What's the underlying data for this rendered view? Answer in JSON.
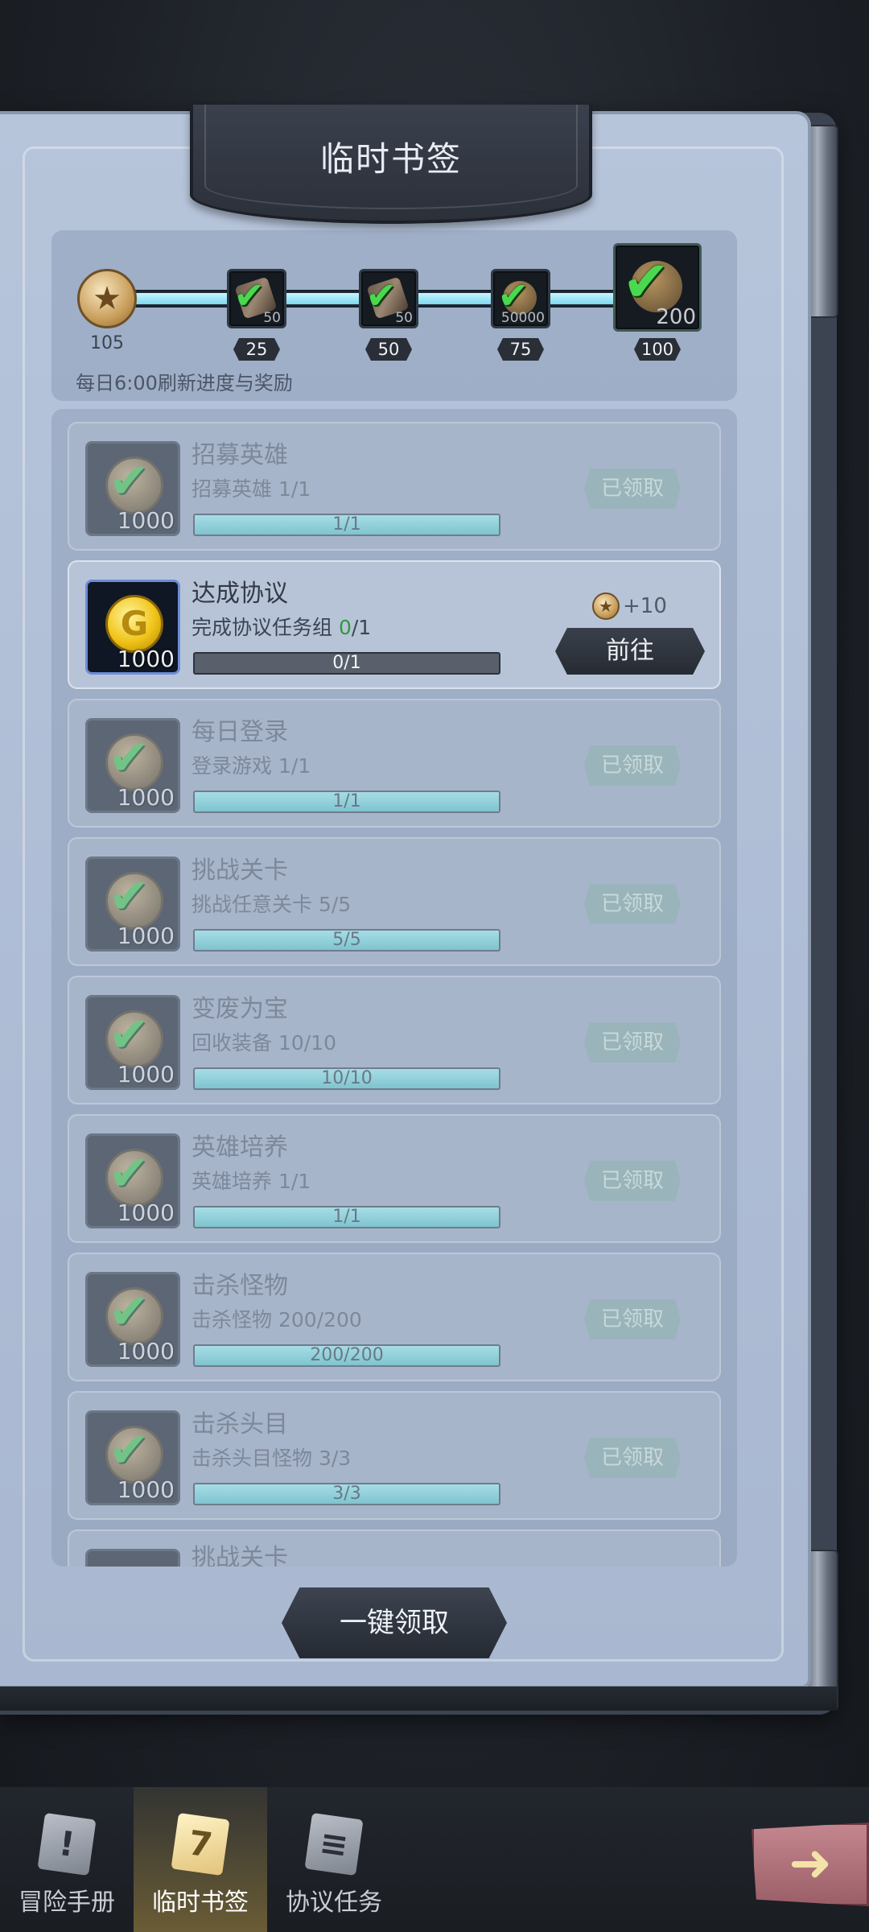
{
  "header": {
    "title": "临时书签"
  },
  "progress": {
    "current_points": "105",
    "fill_fraction": 1.0,
    "reset_note": "每日6:00刷新进度与奖励",
    "milestones": [
      {
        "threshold": "25",
        "qty": "50",
        "icon": "scroll-icon",
        "claimed": true
      },
      {
        "threshold": "50",
        "qty": "50",
        "icon": "parchment-icon",
        "claimed": true
      },
      {
        "threshold": "75",
        "qty": "50000",
        "icon": "gold-coin-icon",
        "claimed": true
      },
      {
        "threshold": "100",
        "qty": "200",
        "icon": "rune-stone-icon",
        "claimed": true
      }
    ]
  },
  "tasks": [
    {
      "title": "招募英雄",
      "desc": "招募英雄 1/1",
      "bar": "1/1",
      "fraction": 1.0,
      "reward": "1000",
      "status": "已领取"
    },
    {
      "title": "达成协议",
      "desc_prefix": "完成协议任务组 ",
      "desc_count": "0",
      "desc_total": "/1",
      "bar": "0/1",
      "fraction": 0.0,
      "reward": "1000",
      "points": "+10",
      "button": "前往"
    },
    {
      "title": "每日登录",
      "desc": "登录游戏 1/1",
      "bar": "1/1",
      "fraction": 1.0,
      "reward": "1000",
      "status": "已领取"
    },
    {
      "title": "挑战关卡",
      "desc": "挑战任意关卡 5/5",
      "bar": "5/5",
      "fraction": 1.0,
      "reward": "1000",
      "status": "已领取"
    },
    {
      "title": "变废为宝",
      "desc": "回收装备 10/10",
      "bar": "10/10",
      "fraction": 1.0,
      "reward": "1000",
      "status": "已领取"
    },
    {
      "title": "英雄培养",
      "desc": "英雄培养 1/1",
      "bar": "1/1",
      "fraction": 1.0,
      "reward": "1000",
      "status": "已领取"
    },
    {
      "title": "击杀怪物",
      "desc": "击杀怪物 200/200",
      "bar": "200/200",
      "fraction": 1.0,
      "reward": "1000",
      "status": "已领取"
    },
    {
      "title": "击杀头目",
      "desc": "击杀头目怪物 3/3",
      "bar": "3/3",
      "fraction": 1.0,
      "reward": "1000",
      "status": "已领取"
    },
    {
      "title": "挑战关卡"
    }
  ],
  "claim_all_label": "一键领取",
  "nav": {
    "tabs": [
      {
        "label": "冒险手册",
        "icon": "adventure-manual-icon",
        "glyph": "!"
      },
      {
        "label": "临时书签",
        "icon": "bookmark-scroll-icon",
        "glyph": "7",
        "active": true
      },
      {
        "label": "协议任务",
        "icon": "agreement-documents-icon",
        "glyph": "≡"
      }
    ],
    "next_icon": "arrow-right-icon"
  },
  "colors": {
    "page": "#b7c5db",
    "progress_fill": "#7ed8ee",
    "check": "#48d14f",
    "highlight": "#2f9a3c"
  }
}
